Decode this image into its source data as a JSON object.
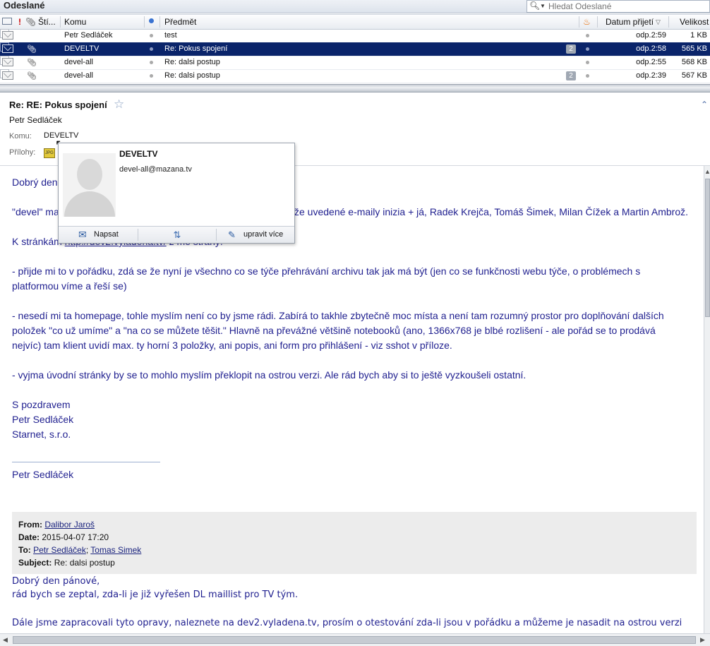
{
  "folder_title": "Odeslané",
  "search": {
    "placeholder": "Hledat Odeslané"
  },
  "columns": {
    "sti": "Ští...",
    "komu": "Komu",
    "predmet": "Předmět",
    "datum": "Datum přijetí",
    "velikost": "Velikost"
  },
  "messages": [
    {
      "to": "Petr Sedláček",
      "subject": "test",
      "count": "",
      "date": "odp.2:59",
      "size": "1 KB",
      "attachment": false,
      "selected": false
    },
    {
      "to": "DEVELTV",
      "subject": "Re: Pokus spojení",
      "count": "2",
      "date": "odp.2:58",
      "size": "565 KB",
      "attachment": true,
      "selected": true
    },
    {
      "to": "devel-all",
      "subject": "Re: dalsi postup",
      "count": "",
      "date": "odp.2:55",
      "size": "568 KB",
      "attachment": true,
      "selected": false
    },
    {
      "to": "devel-all",
      "subject": "Re: dalsi postup",
      "count": "2",
      "date": "odp.2:39",
      "size": "567 KB",
      "attachment": true,
      "selected": false
    }
  ],
  "message": {
    "subject": "Re: RE: Pokus spojení",
    "sender": "Petr Sedláček",
    "to_label": "Komu:",
    "to_value": "DEVELTV",
    "attachments_label": "Přílohy:"
  },
  "contact_popup": {
    "name": "DEVELTV",
    "email": "devel-all@mazana.tv",
    "write_label": "Napsat",
    "edit_label": "upravit více"
  },
  "body": {
    "greeting": "Dobrý den",
    "line_devel_start": "\"devel\" ma",
    "line_devel_end": "že uvedené e-maily inizia + já, Radek Krejča, Tomáš  Šimek, Milan Čížek a Martin Ambrož.",
    "line_pages_start": "K stránkám",
    "line_pages_link": "http://dev2.vyladena.tv/",
    "line_pages_end": " z mé strany:",
    "p1_l1": "-  přijde mi to v pořádku,  zdá se že nyní je všechno co se týče přehrávání archivu tak jak má být (jen co se funkčnosti webu týče, o problémech s",
    "p1_l2": "platformou víme a řeší se)",
    "p2_l1": "- nesedí mi ta homepage, tohle myslím  není co by jsme rádi. Zabírá to takhle zbytečně moc místa a není tam rozumný prostor pro doplňování dalších",
    "p2_l2": "položek \"co už umíme\" a \"na co se můžete těšit.\" Hlavně na převážné většině notebooků  (ano, 1366x768 je blbé rozlišení - ale pořád se to prodává",
    "p2_l3": "nejvíc) tam klient uvidí max. ty horní 3 položky, ani popis, ani form pro přihlášení - viz sshot v příloze.",
    "p3": "- vyjma úvodní stránky by se to mohlo myslím překlopit na ostrou verzi. Ale rád bych aby si to ještě vyzkoušeli ostatní.",
    "sig1": "S pozdravem",
    "sig2": "Petr Sedláček",
    "sig3": "Starnet, s.r.o.",
    "sig_name": "Petr Sedláček"
  },
  "quote": {
    "from_label": "From:",
    "from": "Dalibor Jaroš",
    "date_label": "Date:",
    "date": "2015-04-07 17:20",
    "to_label": "To:",
    "to1": "Petr Sedláček",
    "to2": "Tomas Simek",
    "subject_label": "Subject:",
    "subject": "Re: dalsi postup"
  },
  "quoted_body": {
    "l1": "Dobrý den pánové,",
    "l2": "rád bych se zeptal, zda-li je již vyřešen DL maillist pro TV tým.",
    "l3": "Dále jsme zapracovali tyto opravy, naleznete na dev2.vyladena.tv, prosím o otestování zda-li jsou v pořádku a můžeme je nasadit na ostrou verzi"
  },
  "colors": {
    "selection": "#0a246a",
    "body_text": "#1f1f8f",
    "link": "#1a237e"
  }
}
